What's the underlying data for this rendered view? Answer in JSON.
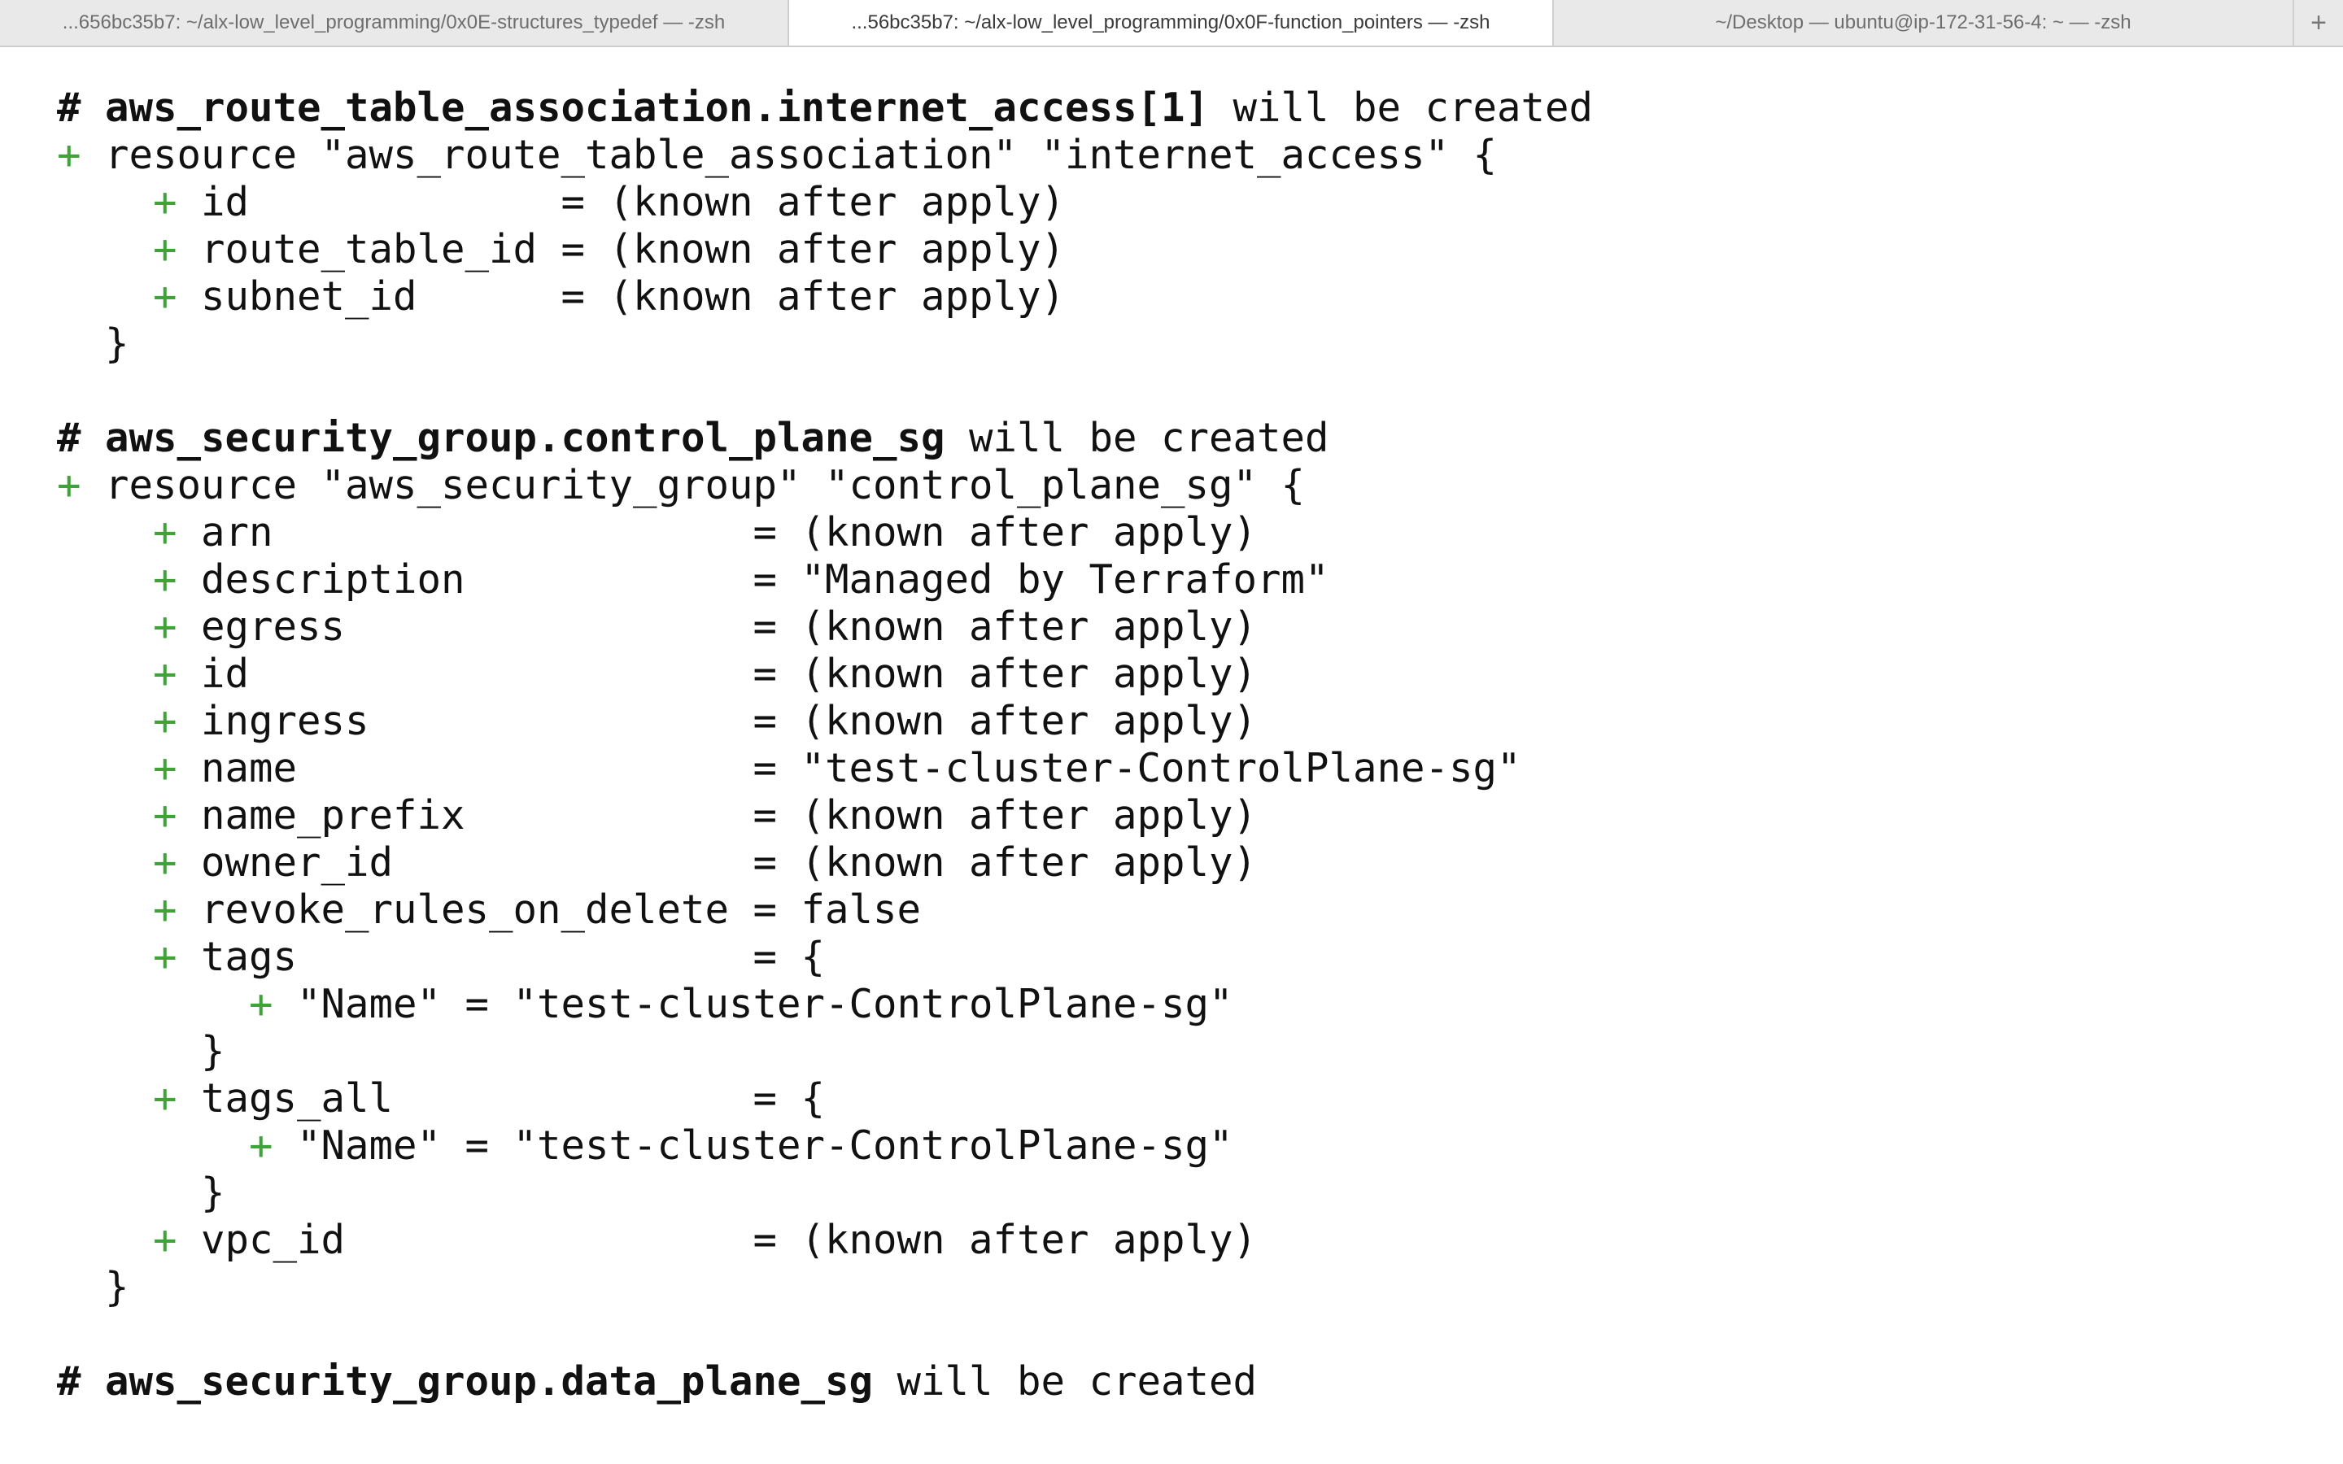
{
  "tabs": [
    {
      "label": "...656bc35b7: ~/alx-low_level_programming/0x0E-structures_typedef — -zsh",
      "active": false
    },
    {
      "label": "...56bc35b7: ~/alx-low_level_programming/0x0F-function_pointers — -zsh",
      "active": true
    },
    {
      "label": "~/Desktop — ubuntu@ip-172-31-56-4: ~ — -zsh",
      "active": false
    }
  ],
  "new_tab_label": "+",
  "terminal": {
    "lines": [
      {
        "kind": "comment",
        "text": "# aws_route_table_association.internet_access[1] will be created",
        "bold": "aws_route_table_association.internet_access[1]"
      },
      {
        "kind": "resource",
        "indent": "",
        "text": "resource \"aws_route_table_association\" \"internet_access\" {"
      },
      {
        "kind": "attr",
        "indent": "    ",
        "text": "id             = (known after apply)"
      },
      {
        "kind": "attr",
        "indent": "    ",
        "text": "route_table_id = (known after apply)"
      },
      {
        "kind": "attr",
        "indent": "    ",
        "text": "subnet_id      = (known after apply)"
      },
      {
        "kind": "plain",
        "text": "  }"
      },
      {
        "kind": "blank",
        "text": ""
      },
      {
        "kind": "comment",
        "text": "# aws_security_group.control_plane_sg will be created",
        "bold": "aws_security_group.control_plane_sg"
      },
      {
        "kind": "resource",
        "indent": "",
        "text": "resource \"aws_security_group\" \"control_plane_sg\" {"
      },
      {
        "kind": "attr",
        "indent": "    ",
        "text": "arn                    = (known after apply)"
      },
      {
        "kind": "attr",
        "indent": "    ",
        "text": "description            = \"Managed by Terraform\""
      },
      {
        "kind": "attr",
        "indent": "    ",
        "text": "egress                 = (known after apply)"
      },
      {
        "kind": "attr",
        "indent": "    ",
        "text": "id                     = (known after apply)"
      },
      {
        "kind": "attr",
        "indent": "    ",
        "text": "ingress                = (known after apply)"
      },
      {
        "kind": "attr",
        "indent": "    ",
        "text": "name                   = \"test-cluster-ControlPlane-sg\""
      },
      {
        "kind": "attr",
        "indent": "    ",
        "text": "name_prefix            = (known after apply)"
      },
      {
        "kind": "attr",
        "indent": "    ",
        "text": "owner_id               = (known after apply)"
      },
      {
        "kind": "attr",
        "indent": "    ",
        "text": "revoke_rules_on_delete = false"
      },
      {
        "kind": "attr",
        "indent": "    ",
        "text": "tags                   = {"
      },
      {
        "kind": "attr",
        "indent": "        ",
        "text": "\"Name\" = \"test-cluster-ControlPlane-sg\""
      },
      {
        "kind": "plain",
        "text": "      }"
      },
      {
        "kind": "attr",
        "indent": "    ",
        "text": "tags_all               = {"
      },
      {
        "kind": "attr",
        "indent": "        ",
        "text": "\"Name\" = \"test-cluster-ControlPlane-sg\""
      },
      {
        "kind": "plain",
        "text": "      }"
      },
      {
        "kind": "attr",
        "indent": "    ",
        "text": "vpc_id                 = (known after apply)"
      },
      {
        "kind": "plain",
        "text": "  }"
      },
      {
        "kind": "blank",
        "text": ""
      },
      {
        "kind": "comment",
        "text": "# aws_security_group.data_plane_sg will be created",
        "bold": "aws_security_group.data_plane_sg"
      }
    ]
  },
  "colors": {
    "plus": "#3fa33a",
    "text": "#111111",
    "background": "#ffffff"
  }
}
